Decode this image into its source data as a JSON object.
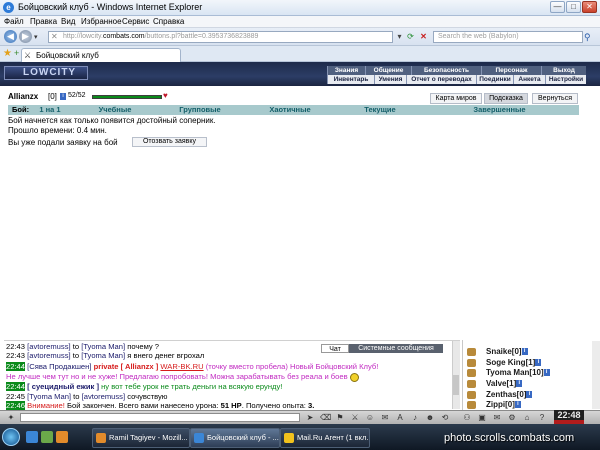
{
  "window": {
    "title": "Бойцовский клуб - Windows Internet Explorer",
    "minimize": "—",
    "maximize": "□",
    "close": "✕"
  },
  "menu": [
    "Файл",
    "Правка",
    "Вид",
    "Избранное",
    "Сервис",
    "Справка"
  ],
  "address": {
    "prefix": "http://lowcity.",
    "host": "combats.com",
    "suffix": "/buttons.pl?battle=0.3953736823889",
    "search_placeholder": "Search the web (Babylon)"
  },
  "tab": {
    "label": "Бойцовский клуб"
  },
  "game": {
    "logo": "LOWCITY",
    "nav_top": [
      "Знания",
      "Общение",
      "Безопасность",
      "Персонаж",
      "Выход"
    ],
    "nav_bottom": [
      "Инвентарь",
      "Умения",
      "Отчет о переводах",
      "Поединки",
      "Анкета",
      "Настройки"
    ]
  },
  "fight": {
    "player_name": "Allianzx",
    "player_level": "[0]",
    "hp": "52/52",
    "hp_fraction": 1.0,
    "buttons": {
      "map": "Карта миров",
      "hint": "Подсказка",
      "back": "Вернуться"
    },
    "tabs_label": "Бой:",
    "tabs": [
      "1 на 1",
      "Учебные",
      "Групповые",
      "Хаотичные",
      "Текущие",
      "Завершенные"
    ],
    "line1": "Бой начнется как только появится достойный соперник.",
    "line2": "Прошло времени: 0.4 мин.",
    "line3": "Вы уже подали заявку на бой",
    "withdraw": "Отозвать заявку"
  },
  "chat": {
    "tab_main": "Чат",
    "tab_system": "Системные сообщения",
    "lines": [
      {
        "time": "22:43",
        "name": "[avtoremuss]",
        "to": "to",
        "target": "[Tyoma Man]",
        "text": "почему ?"
      },
      {
        "time": "22:43",
        "name": "[avtoremuss]",
        "to": "to",
        "target": "[Tyoma Man]",
        "text": "я внего денег вгрохал"
      },
      {
        "time": "22:44",
        "name": "[Сява Продакшен]",
        "private": "private [ Allianzx ]",
        "link": "WAR-BK.RU",
        "text": "(точку вместо пробела) Новый Бойцовский Клуб!"
      },
      {
        "text": "Не лучше чем тут но и не хуже! Предлагаю попробовать! Можна зарабатывать без реала и боев"
      },
      {
        "time": "22:44",
        "name": "[ суецидный ежик ]",
        "text": "ну вот тебе урок не трать деньги на всякую ерунду!"
      },
      {
        "time": "22:45",
        "name": "[Tyoma Man]",
        "to": "to",
        "target": "[avtoremuss]",
        "text": "сочувствую"
      },
      {
        "time": "22:46",
        "alert": "Внимание!",
        "text": "Бой закончен. Всего вами нанесено урона:",
        "dmg": "51 HP",
        "after": ". Получено опыта:",
        "exp": "3."
      }
    ]
  },
  "online": [
    {
      "name": "Snaike",
      "level": "[0]"
    },
    {
      "name": "Soge King",
      "level": "[1]"
    },
    {
      "name": "Tyoma Man",
      "level": "[10]"
    },
    {
      "name": "Valve",
      "level": "[1]"
    },
    {
      "name": "Zenthas",
      "level": "[0]"
    },
    {
      "name": "Zippi",
      "level": "[0]"
    }
  ],
  "clock": "22:48",
  "taskbar": [
    {
      "label": "Ramil Tagiyev - Mozill..."
    },
    {
      "label": "Бойцовский клуб - ..."
    },
    {
      "label": "Mail.Ru Агент (1 вкл..."
    }
  ],
  "watermark": "photo.scrolls.combats.com",
  "colors": {
    "game_header": "#1d2a4a",
    "fight_tabs": "#a7c9cc",
    "hp_bar": "#0a8a1a",
    "chat_private": "#d61b1b",
    "chat_magenta": "#c12ac1"
  }
}
